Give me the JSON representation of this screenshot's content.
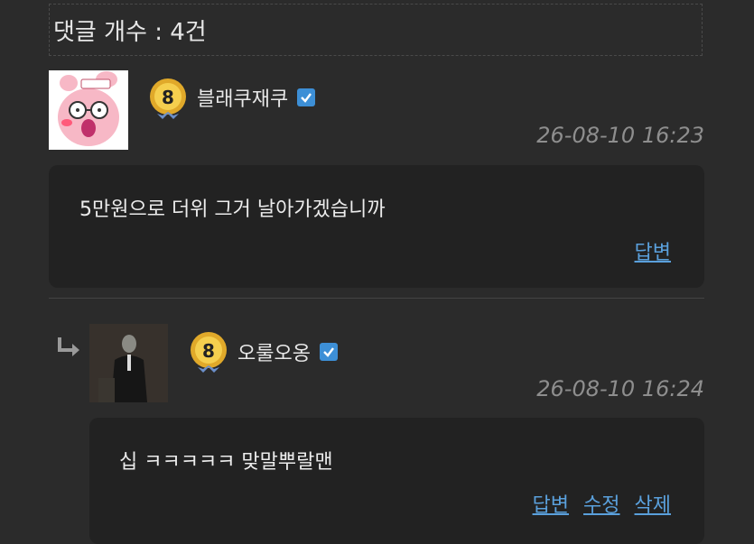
{
  "comments_header": {
    "label": "댓글 개수 : 4건"
  },
  "comments": [
    {
      "author": "블래쿠재쿠",
      "level": "8",
      "date": "26-08-10 16:23",
      "body": "5만원으로 더위 그거 날아가겠습니까",
      "actions": [
        "답변"
      ]
    },
    {
      "author": "오룰오옹",
      "level": "8",
      "date": "26-08-10 16:24",
      "body": "십 ㅋㅋㅋㅋㅋ 맞말뿌랄맨",
      "actions": [
        "답변",
        "수정",
        "삭제"
      ]
    }
  ],
  "colors": {
    "background": "#2b2b2b",
    "comment_box": "#222222",
    "link": "#5aa0dc",
    "verify": "#3d8fd6"
  }
}
